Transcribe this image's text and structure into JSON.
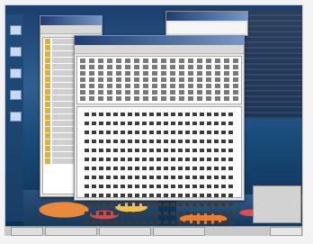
{
  "screen": {
    "description": "",
    "windows": {
      "explorer": {},
      "mail": {},
      "header": {}
    },
    "taskbar": {}
  }
}
